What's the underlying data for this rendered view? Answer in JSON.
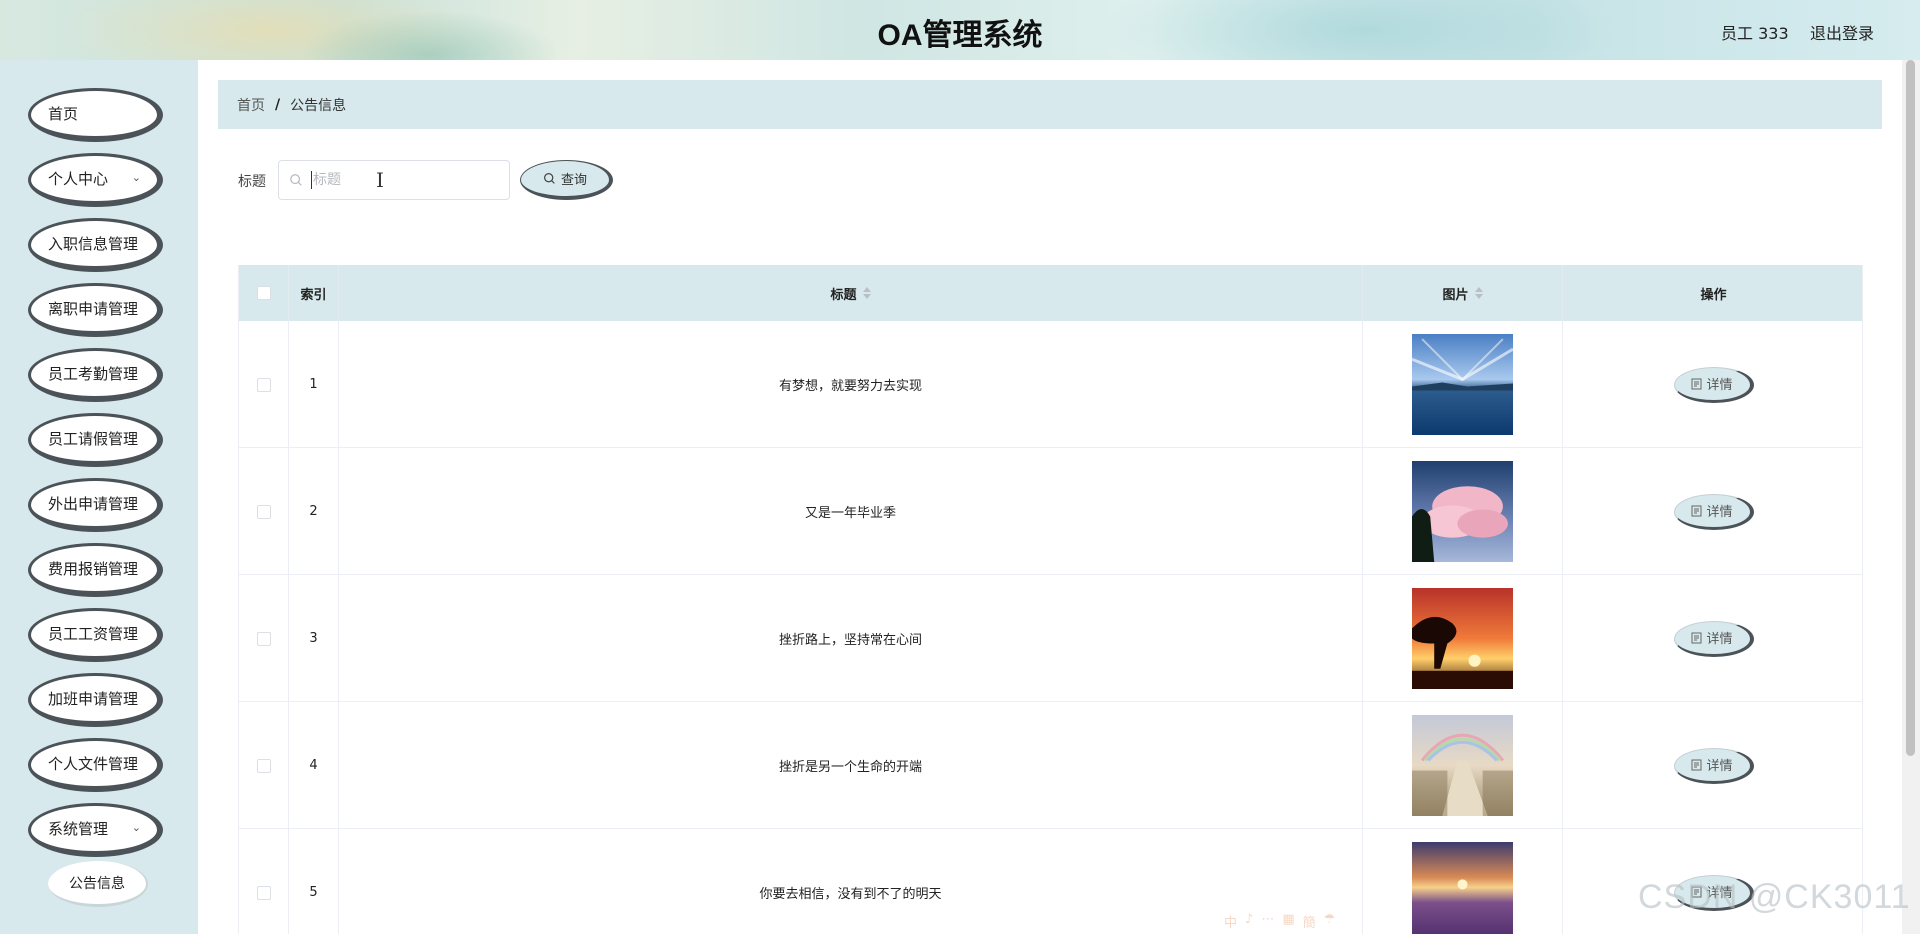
{
  "header": {
    "title": "OA管理系统",
    "user": "员工 333",
    "logout": "退出登录"
  },
  "sidebar": {
    "items": [
      {
        "label": "首页",
        "has_submenu": false
      },
      {
        "label": "个人中心",
        "has_submenu": true
      },
      {
        "label": "入职信息管理",
        "has_submenu": false
      },
      {
        "label": "离职申请管理",
        "has_submenu": false
      },
      {
        "label": "员工考勤管理",
        "has_submenu": false
      },
      {
        "label": "员工请假管理",
        "has_submenu": false
      },
      {
        "label": "外出申请管理",
        "has_submenu": false
      },
      {
        "label": "费用报销管理",
        "has_submenu": false
      },
      {
        "label": "员工工资管理",
        "has_submenu": false
      },
      {
        "label": "加班申请管理",
        "has_submenu": false
      },
      {
        "label": "个人文件管理",
        "has_submenu": false
      },
      {
        "label": "系统管理",
        "has_submenu": true
      }
    ],
    "sub_item": "公告信息"
  },
  "breadcrumb": {
    "home": "首页",
    "separator": "/",
    "current": "公告信息"
  },
  "search": {
    "label": "标题",
    "placeholder": "标题",
    "value": "",
    "button": "查询"
  },
  "table": {
    "columns": {
      "index": "索引",
      "title": "标题",
      "image": "图片",
      "action": "操作"
    },
    "detail_label": "详情",
    "rows": [
      {
        "index": "1",
        "title": "有梦想，就要努力去实现",
        "image": "lake-sky"
      },
      {
        "index": "2",
        "title": "又是一年毕业季",
        "image": "pink-clouds"
      },
      {
        "index": "3",
        "title": "挫折路上，坚持常在心间",
        "image": "sunset-tree"
      },
      {
        "index": "4",
        "title": "挫折是另一个生命的开端",
        "image": "rainbow-path"
      },
      {
        "index": "5",
        "title": "你要去相信，没有到不了的明天",
        "image": "lavender-sunset"
      }
    ]
  },
  "watermark": "CSDN @CK3011",
  "colors": {
    "accent": "#d7e9ec",
    "pill_border": "#4b5358"
  }
}
